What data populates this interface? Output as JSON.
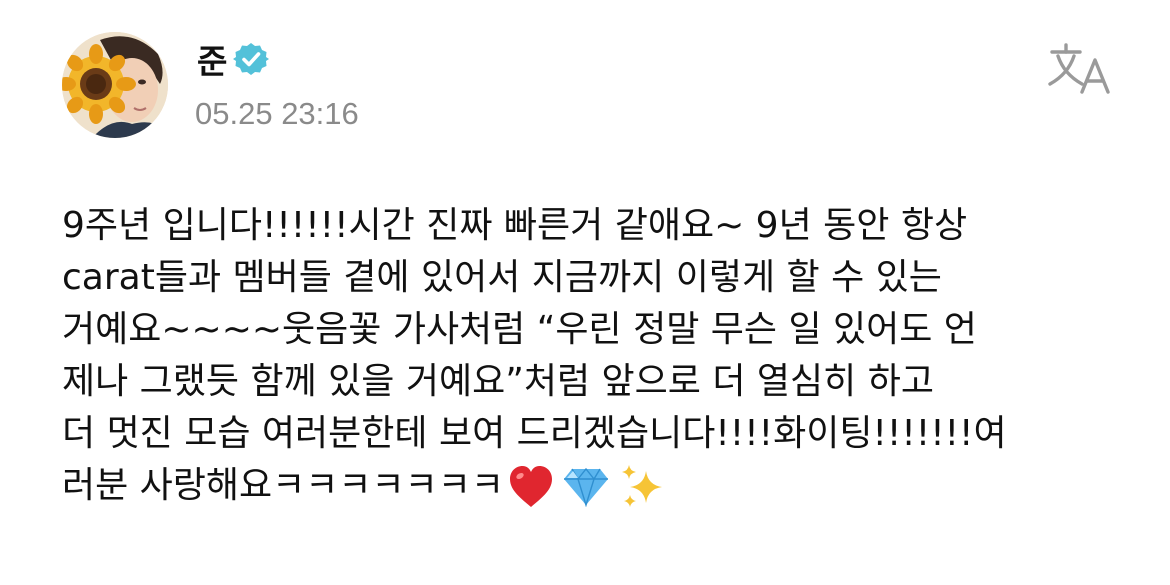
{
  "author": {
    "name": "준",
    "verified": true
  },
  "post": {
    "timestamp": "05.25 23:16",
    "lines": [
      "9주년 입니다!!!!!!시간 진짜 빠른거 같애요~ 9년 동안 항상",
      "carat들과 멤버들 곁에 있어서 지금까지 이렇게 할 수 있는",
      "거예요~~~~웃음꽃 가사처럼 “우린 정말 무슨 일 있어도 언",
      "제나 그랬듯 함께 있을 거예요”처럼 앞으로 더 열심히 하고",
      "더 멋진 모습 여러분한테 보여 드리겠습니다!!!!화이팅!!!!!!!여",
      "러분 사랑해요ㅋㅋㅋㅋㅋㅋㅋ"
    ],
    "emojis": [
      "heart-emoji",
      "gem-emoji",
      "sparkles-emoji"
    ]
  },
  "icons": {
    "verified": "verified-badge-icon",
    "translate": "translate-icon"
  },
  "colors": {
    "verified_badge": "#53c1d9",
    "timestamp": "#8a8a8a",
    "text": "#111111",
    "translate_icon": "#9a9a9a"
  }
}
